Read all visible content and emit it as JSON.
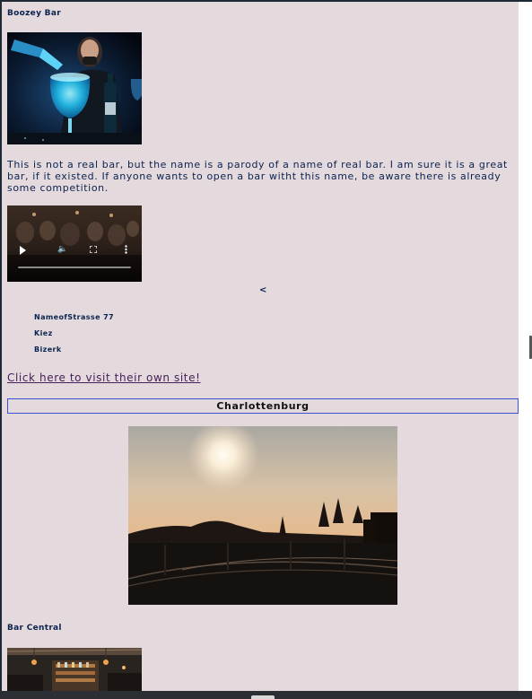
{
  "bars": [
    {
      "name": "Boozey Bar",
      "description": "This is not a real bar, but the name is a parody of a name of real bar. I am sure it is a great bar, if it existed. If anyone wants to open a bar witht this name, be aware there is already some competition.",
      "carousel_prev": "<",
      "address": {
        "street": "NameofStrasse 77",
        "kiez": "Kiez",
        "bezirk": "Bizerk"
      },
      "link_text": "Click here to visit their own site!"
    },
    {
      "name": "Bar Central"
    }
  ],
  "district": {
    "name": "Charlottenburg"
  },
  "icons": {
    "play": "play-icon",
    "volume": "volume-icon",
    "fullscreen": "fullscreen-icon",
    "more": "more-vertical-icon"
  }
}
